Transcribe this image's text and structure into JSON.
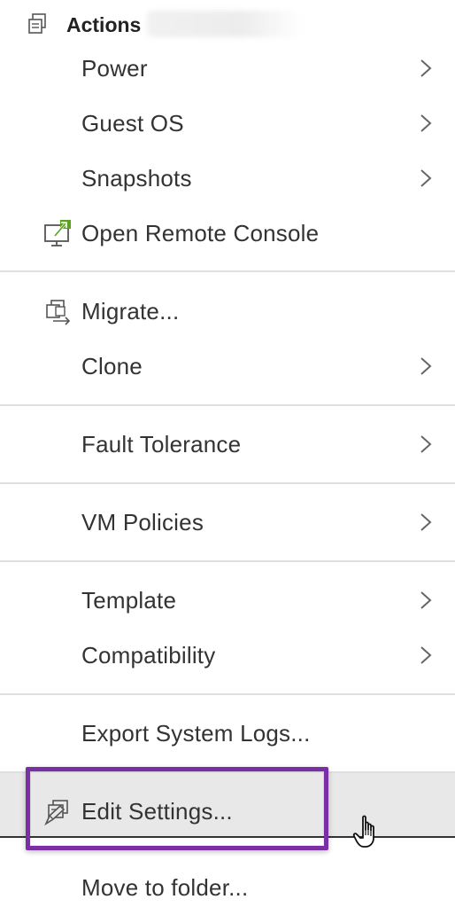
{
  "header": {
    "title": "Actions",
    "icon": "vm-actions-icon"
  },
  "menu": {
    "items": [
      {
        "label": "Power",
        "has_submenu": true
      },
      {
        "label": "Guest OS",
        "has_submenu": true
      },
      {
        "label": "Snapshots",
        "has_submenu": true
      },
      {
        "label": "Open Remote Console",
        "has_submenu": false,
        "icon": "remote-console-icon"
      },
      {
        "label": "Migrate...",
        "has_submenu": false,
        "icon": "migrate-icon"
      },
      {
        "label": "Clone",
        "has_submenu": true
      },
      {
        "label": "Fault Tolerance",
        "has_submenu": true
      },
      {
        "label": "VM Policies",
        "has_submenu": true
      },
      {
        "label": "Template",
        "has_submenu": true
      },
      {
        "label": "Compatibility",
        "has_submenu": true
      },
      {
        "label": "Export System Logs...",
        "has_submenu": false
      },
      {
        "label": "Edit Settings...",
        "has_submenu": false,
        "icon": "edit-settings-icon",
        "highlighted": true
      },
      {
        "label": "Move to folder...",
        "has_submenu": false
      }
    ]
  },
  "colors": {
    "highlight_border": "#7a2fa6",
    "hover_background": "#e8e8e8",
    "console_accent": "#5aa220",
    "text": "#333333"
  }
}
